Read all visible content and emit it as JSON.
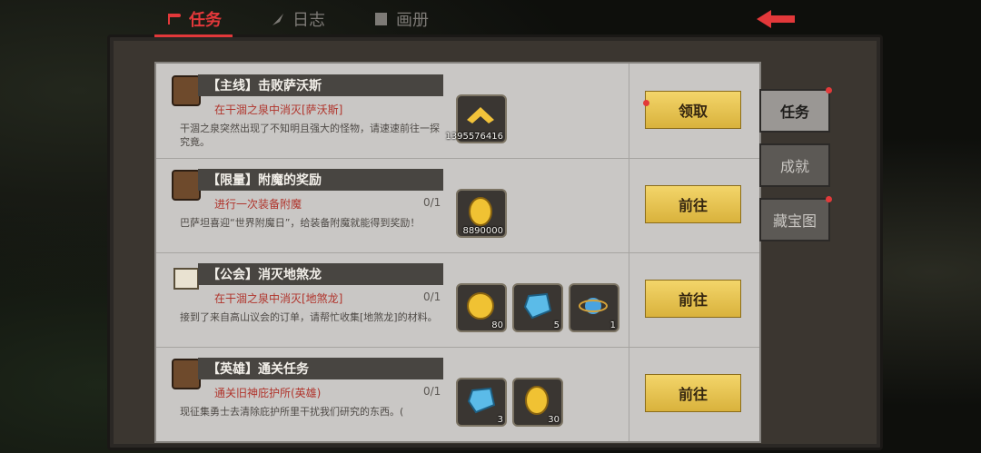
{
  "tabs": [
    {
      "label": "任务",
      "icon": "scroll-icon",
      "active": true
    },
    {
      "label": "日志",
      "icon": "feather-icon",
      "active": false
    },
    {
      "label": "画册",
      "icon": "album-icon",
      "active": false
    }
  ],
  "back_icon": "back-arrow-icon",
  "quests": [
    {
      "title": "【主线】击败萨沃斯",
      "objective": "在干涸之泉中消灭[萨沃斯]",
      "count": "",
      "description": "干涸之泉突然出现了不知明且强大的怪物，请速速前往一探究竟。",
      "rewards": [
        {
          "icon": "rank-chevron-icon",
          "qty": "1395576416"
        }
      ],
      "action": "领取",
      "action_dot": true
    },
    {
      "title": "【限量】附魔的奖励",
      "objective": "进行一次装备附魔",
      "count": "0/1",
      "description": "巴萨坦喜迎“世界附魔日”，给装备附魔就能得到奖励！",
      "rewards": [
        {
          "icon": "gold-coin-icon",
          "qty": "8890000"
        }
      ],
      "action": "前往",
      "action_dot": false
    },
    {
      "title": "【公会】消灭地煞龙",
      "objective": "在干涸之泉中消灭[地煞龙]",
      "count": "0/1",
      "description": "接到了来自高山议会的订单，请帮忙收集[地煞龙]的材料。",
      "rewards": [
        {
          "icon": "guild-coin-icon",
          "qty": "80"
        },
        {
          "icon": "blue-crystal-icon",
          "qty": "5"
        },
        {
          "icon": "orb-icon",
          "qty": "1"
        }
      ],
      "action": "前往",
      "action_dot": false
    },
    {
      "title": "【英雄】通关任务",
      "objective": "通关旧神庇护所(英雄)",
      "count": "0/1",
      "description": "现征集勇士去清除庇护所里干扰我们研究的东西。(",
      "rewards": [
        {
          "icon": "blue-crystal-icon",
          "qty": "3"
        },
        {
          "icon": "gold-coin-icon",
          "qty": "30"
        }
      ],
      "action": "前往",
      "action_dot": false
    }
  ],
  "side_tabs": [
    {
      "label": "任务",
      "active": true,
      "dot": true
    },
    {
      "label": "成就",
      "active": false,
      "dot": false
    },
    {
      "label": "藏宝图",
      "active": false,
      "dot": true
    }
  ],
  "colors": {
    "accent": "#e2383a",
    "button": "#f0cc55",
    "panel": "#c9c7c5"
  }
}
